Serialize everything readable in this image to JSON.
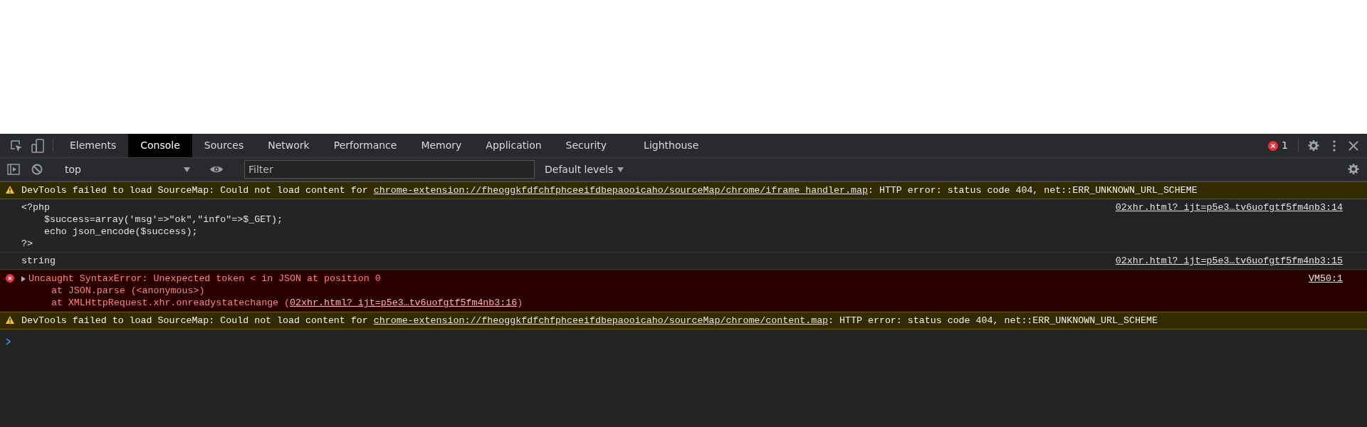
{
  "tabs": [
    {
      "label": "Elements",
      "selected": false
    },
    {
      "label": "Console",
      "selected": true
    },
    {
      "label": "Sources",
      "selected": false
    },
    {
      "label": "Network",
      "selected": false
    },
    {
      "label": "Performance",
      "selected": false
    },
    {
      "label": "Memory",
      "selected": false
    },
    {
      "label": "Application",
      "selected": false
    },
    {
      "label": "Security",
      "selected": false
    },
    {
      "label": "Lighthouse",
      "selected": false
    }
  ],
  "error_count": "1",
  "toolbar": {
    "context": "top",
    "filter": {
      "placeholder": "Filter"
    },
    "levels": "Default levels"
  },
  "messages": [
    {
      "kind": "warning",
      "text": "DevTools failed to load SourceMap: Could not load content for ",
      "link": "chrome-extension://fheoggkfdfchfphceeifdbepaooicaho/sourceMap/chrome/iframe_handler.map",
      "after": ": HTTP error: status code 404, net::ERR_UNKNOWN_URL_SCHEME"
    },
    {
      "kind": "log",
      "lines": [
        {
          "text": "<?php"
        },
        {
          "text": "    $success=array('msg'=>\"ok\",\"info\"=>$_GET);"
        },
        {
          "text": "    echo json_encode($success);"
        },
        {
          "text": "?>"
        }
      ],
      "source": "02xhr.html?_ijt=p5e3…tv6uofgtf5fm4nb3:14"
    },
    {
      "kind": "log",
      "lines": [
        {
          "text": "string"
        }
      ],
      "source": "02xhr.html?_ijt=p5e3…tv6uofgtf5fm4nb3:15"
    },
    {
      "kind": "error",
      "expanded": false,
      "lines": [
        {
          "text": "Uncaught SyntaxError: Unexpected token < in JSON at position 0"
        },
        {
          "text": "    at JSON.parse (<anonymous>)"
        },
        {
          "text": "    at XMLHttpRequest.xhr.onreadystatechange (",
          "link": "02xhr.html?_ijt=p5e3…tv6uofgtf5fm4nb3:16",
          "after": ")"
        }
      ],
      "source": "VM50:1"
    },
    {
      "kind": "warning",
      "text": "DevTools failed to load SourceMap: Could not load content for ",
      "link": "chrome-extension://fheoggkfdfchfphceeifdbepaooicaho/sourceMap/chrome/content.map",
      "after": ": HTTP error: status code 404, net::ERR_UNKNOWN_URL_SCHEME"
    }
  ]
}
